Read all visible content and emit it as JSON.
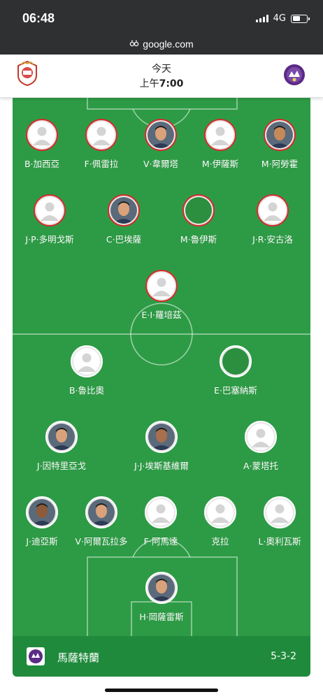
{
  "status_bar": {
    "time": "06:48",
    "network": "4G"
  },
  "browser": {
    "url": "google.com"
  },
  "match": {
    "day": "今天",
    "time_prefix": "上午",
    "time": "7:00"
  },
  "team": {
    "name": "馬薩特蘭",
    "formation": "5-3-2"
  },
  "colors": {
    "pitch": "#2d9b45",
    "footer": "#1f8a3b",
    "home_ring": "#d42c2c",
    "away_ring": "#ffffff"
  },
  "home_players": [
    {
      "name": "B·加西亞",
      "photo": "placeholder"
    },
    {
      "name": "F·佩雷拉",
      "photo": "placeholder"
    },
    {
      "name": "V·韋爾塔",
      "photo": "photo"
    },
    {
      "name": "M·伊薩斯",
      "photo": "placeholder"
    },
    {
      "name": "M·阿勞霍",
      "photo": "photo"
    },
    {
      "name": "J·P·多明戈斯",
      "photo": "placeholder"
    },
    {
      "name": "C·巴埃薩",
      "photo": "photo"
    },
    {
      "name": "M·魯伊斯",
      "photo": "empty"
    },
    {
      "name": "J·R·安古洛",
      "photo": "placeholder"
    },
    {
      "name": "E·I·羅培茲",
      "photo": "placeholder"
    }
  ],
  "away_players": [
    {
      "name": "B·魯比奧",
      "photo": "placeholder"
    },
    {
      "name": "E·巴塞納斯",
      "photo": "empty"
    },
    {
      "name": "J·因特里亞戈",
      "photo": "photo"
    },
    {
      "name": "J·J·埃斯基維爾",
      "photo": "photo"
    },
    {
      "name": "A·蒙塔托",
      "photo": "placeholder"
    },
    {
      "name": "J·迪亞斯",
      "photo": "photo"
    },
    {
      "name": "V·阿爾瓦拉多",
      "photo": "photo"
    },
    {
      "name": "F·阿馬達",
      "photo": "placeholder"
    },
    {
      "name": "克拉",
      "photo": "placeholder"
    },
    {
      "name": "L·奧利瓦斯",
      "photo": "placeholder"
    },
    {
      "name": "H·岡薩雷斯",
      "photo": "photo"
    }
  ]
}
